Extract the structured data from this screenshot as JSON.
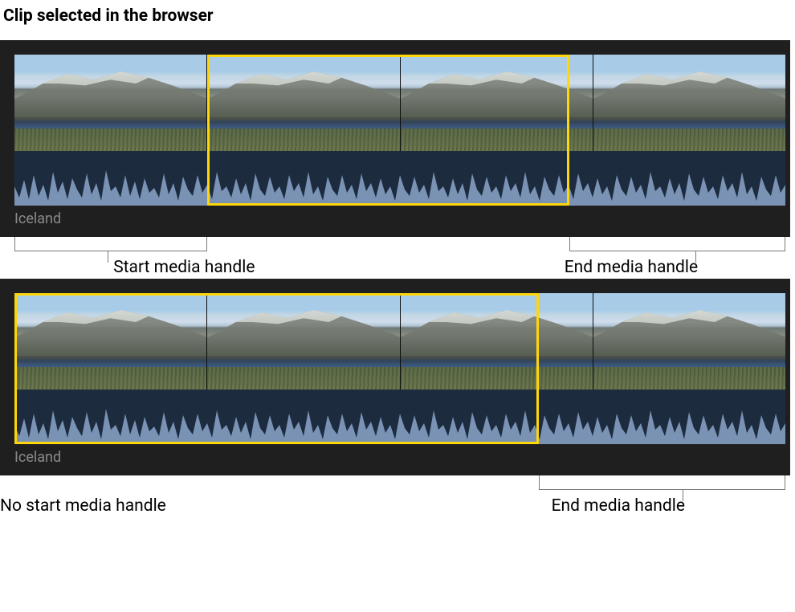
{
  "title": "Clip selected in the browser",
  "clip1": {
    "name": "Iceland",
    "selectionStartPct": 25,
    "selectionEndPct": 72,
    "labels": {
      "start": "Start media handle",
      "end": "End media handle"
    }
  },
  "clip2": {
    "name": "Iceland",
    "selectionStartPct": 0,
    "selectionEndPct": 68,
    "labels": {
      "start": "No start media handle",
      "end": "End media handle"
    }
  },
  "colors": {
    "selection": "#ffd60a",
    "waveformFill": "#7a93b5",
    "waveformBg": "#1d2b3f"
  }
}
